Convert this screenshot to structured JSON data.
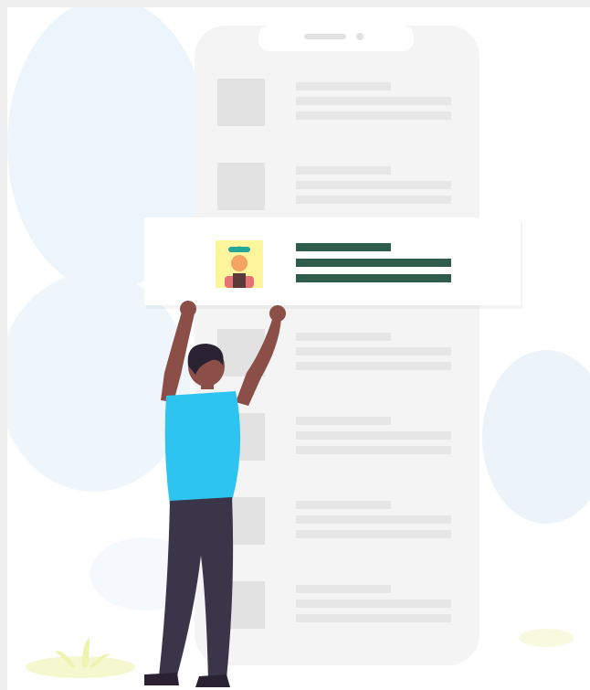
{
  "illustration": {
    "subject": "person-reaching-up-to-highlighted-list-card",
    "colors": {
      "background": "#efefef",
      "card": "#ffffff",
      "phone": "#f3f3f3",
      "placeholder_block": "#e2e2e2",
      "placeholder_line": "#e6e6e6",
      "accent_line": "#2f5d4c",
      "avatar_bg": "#fff59d",
      "avatar_hat": "#26a69a",
      "avatar_skin": "#f4a460",
      "avatar_shirt": "#e57373",
      "shirt": "#2ec4f1",
      "pants": "#3a3548",
      "skin": "#8b4f48",
      "hair": "#2a2233",
      "blob": "#e8f3fb",
      "plant": "#f4f7c5"
    },
    "icons": [
      "worker-avatar-icon"
    ]
  }
}
